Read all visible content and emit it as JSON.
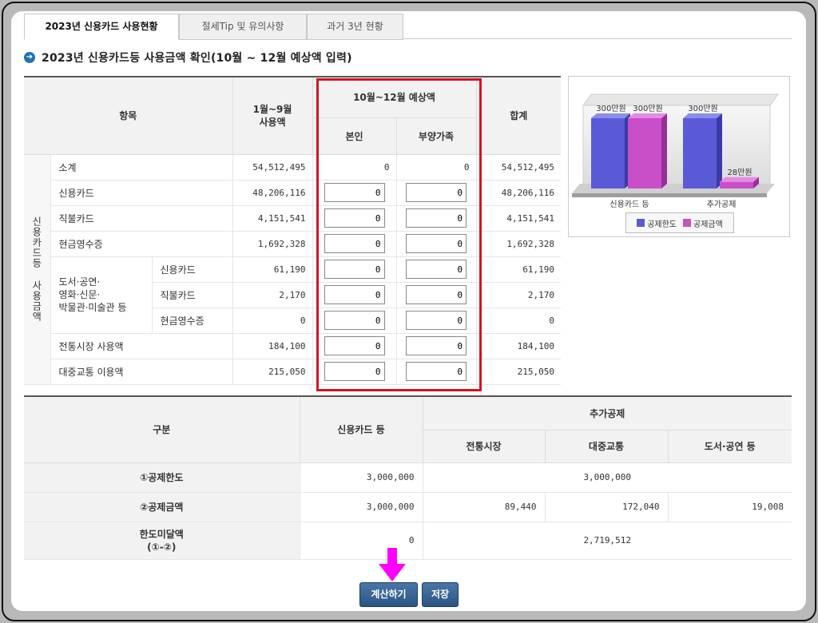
{
  "tabs": [
    {
      "label": "2023년 신용카드 사용현황",
      "active": true
    },
    {
      "label": "절세Tip 및 유의사항",
      "active": false
    },
    {
      "label": "과거 3년 현황",
      "active": false
    }
  ],
  "heading": "2023년 신용카드등 사용금액 확인(10월 ~ 12월 예상액 입력)",
  "main_table": {
    "col_item": "항목",
    "col_jan_sep": "1월~9월\n사용액",
    "col_oct_dec": "10월~12월 예상액",
    "col_self": "본인",
    "col_dependent": "부양가족",
    "col_total": "합계",
    "side_label": "신용카드등 사용금액",
    "rows": [
      {
        "label": "소계",
        "jan_sep": "54,512,495",
        "self": "0",
        "dep": "0",
        "total": "54,512,495"
      },
      {
        "label": "신용카드",
        "jan_sep": "48,206,116",
        "self": "0",
        "dep": "0",
        "total": "48,206,116"
      },
      {
        "label": "직불카드",
        "jan_sep": "4,151,541",
        "self": "0",
        "dep": "0",
        "total": "4,151,541"
      },
      {
        "label": "현금영수증",
        "jan_sep": "1,692,328",
        "self": "0",
        "dep": "0",
        "total": "1,692,328"
      },
      {
        "label": "신용카드",
        "jan_sep": "61,190",
        "self": "0",
        "dep": "0",
        "total": "61,190"
      },
      {
        "label": "직불카드",
        "jan_sep": "2,170",
        "self": "0",
        "dep": "0",
        "total": "2,170"
      },
      {
        "label": "현금영수증",
        "jan_sep": "0",
        "self": "0",
        "dep": "0",
        "total": "0"
      },
      {
        "label": "전통시장 사용액",
        "jan_sep": "184,100",
        "self": "0",
        "dep": "0",
        "total": "184,100"
      },
      {
        "label": "대중교통 이용액",
        "jan_sep": "215,050",
        "self": "0",
        "dep": "0",
        "total": "215,050"
      }
    ],
    "culture_group_label": "도서·공연·\n영화·신문·\n박물관·미술관 등"
  },
  "chart_data": {
    "type": "bar",
    "categories": [
      "신용카드 등",
      "추가공제"
    ],
    "series": [
      {
        "name": "공제한도",
        "values": [
          300,
          300
        ],
        "color": "#5a5ad6"
      },
      {
        "name": "공제금액",
        "values": [
          300,
          28
        ],
        "color": "#c94fc9"
      }
    ],
    "data_labels": [
      [
        "300만원",
        "300만원"
      ],
      [
        "300만원",
        "28만원"
      ]
    ],
    "ylim": [
      0,
      300
    ],
    "legend": "bottom"
  },
  "summary": {
    "col_category": "구분",
    "col_card": "신용카드 등",
    "col_extra": "추가공제",
    "col_market": "전통시장",
    "col_transit": "대중교통",
    "col_culture": "도서·공연 등",
    "row_limit": {
      "label": "①공제한도",
      "card": "3,000,000",
      "extra": "3,000,000"
    },
    "row_amount": {
      "label": "②공제금액",
      "card": "3,000,000",
      "market": "89,440",
      "transit": "172,040",
      "culture": "19,008"
    },
    "row_remain": {
      "label": "한도미달액\n(①-②)",
      "card": "0",
      "extra": "2,719,512"
    }
  },
  "buttons": {
    "calculate": "계산하기",
    "save": "저장"
  },
  "colors": {
    "accent": "#d4141e",
    "button": "#2b5484",
    "arrow": "#ff00ff"
  }
}
